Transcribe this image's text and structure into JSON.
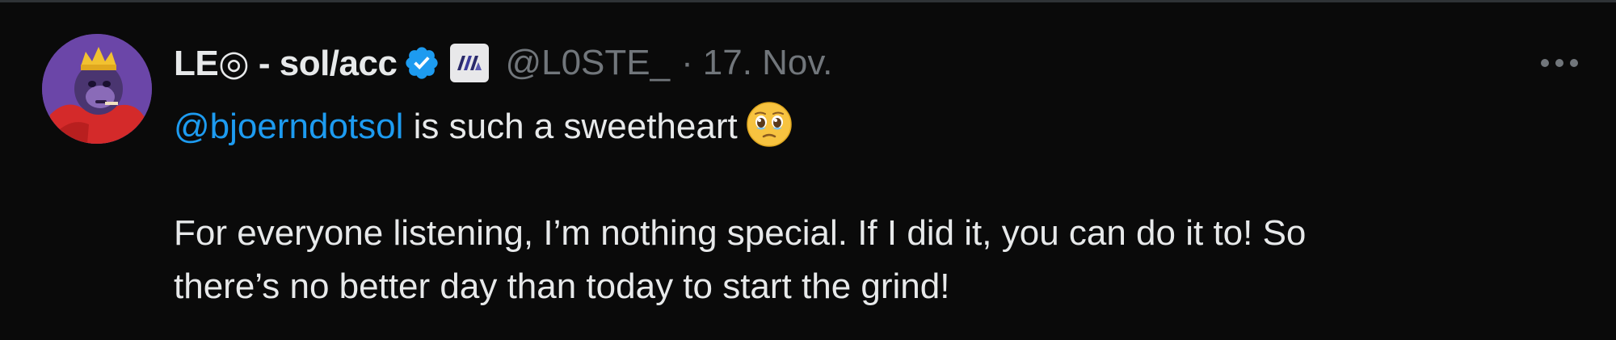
{
  "author": {
    "display_name": "LE◎ - sol/acc",
    "handle": "@L0STE_",
    "separator": "·",
    "date": "17. Nov.",
    "avatar_icon": "gorilla-king-avatar",
    "verified_icon": "verified-badge-icon",
    "affiliate_icon": "affiliate-logo-icon"
  },
  "tweet": {
    "mention": "@bjoerndotsol",
    "first_line_rest": " is such a sweetheart",
    "emoji_icon": "holding-back-tears-emoji",
    "paragraph_line_1": "For everyone listening, I’m nothing special. If I did it, you can do it to! So",
    "paragraph_line_2": "there’s no better day than today to start the grind!"
  },
  "menu": {
    "more_icon": "more-options-icon"
  },
  "colors": {
    "background": "#0a0a0a",
    "text": "#e7e9ea",
    "muted": "#71767b",
    "accent": "#1d9bf0"
  }
}
